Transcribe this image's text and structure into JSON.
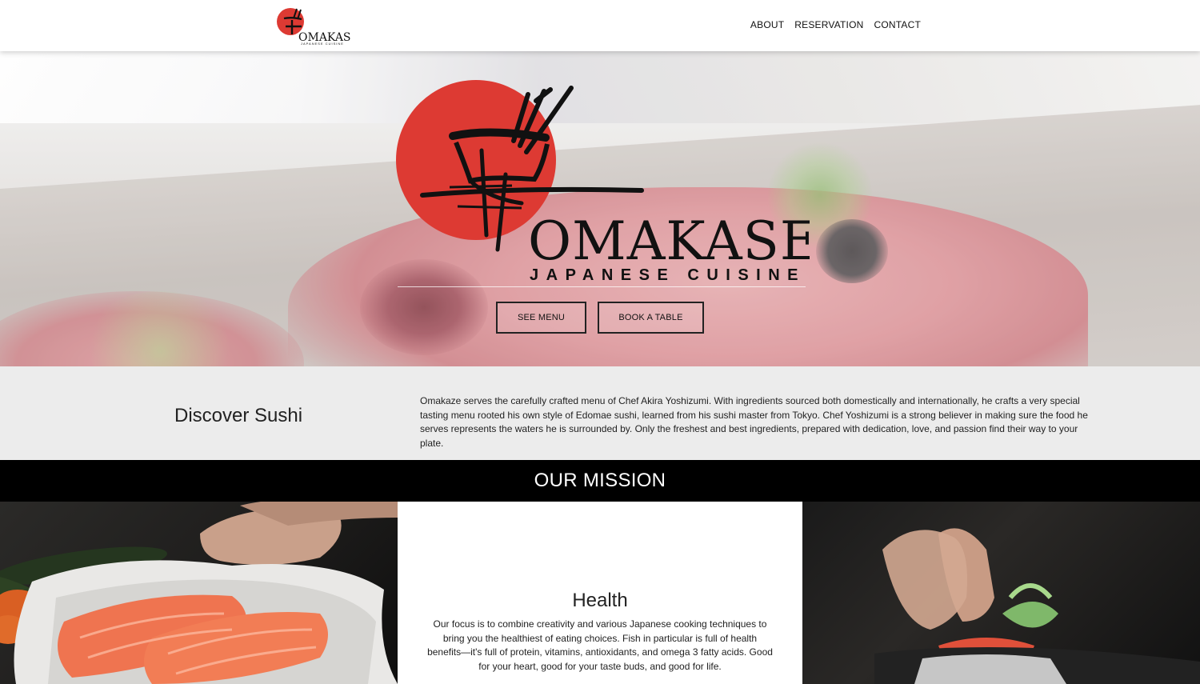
{
  "brand": {
    "name": "OMAKASE",
    "tagline": "JAPANESE CUISINE",
    "red": "#dd3a33"
  },
  "nav": {
    "items": [
      {
        "label": "ABOUT"
      },
      {
        "label": "RESERVATION"
      },
      {
        "label": "CONTACT"
      }
    ]
  },
  "hero": {
    "buttons": {
      "menu": "SEE MENU",
      "book": "BOOK A TABLE"
    }
  },
  "discover": {
    "title": "Discover Sushi",
    "text": "Omakaze serves the carefully crafted menu of Chef Akira Yoshizumi. With ingredients sourced both domestically and internationally, he crafts a very special tasting menu rooted his own style of Edomae sushi, learned from his sushi master from Tokyo. Chef Yoshizumi is a strong believer in making sure the food he serves represents the waters he is surrounded by. Only the freshest and best ingredients, prepared with dedication, love, and passion find their way to your plate."
  },
  "mission": {
    "title": "OUR MISSION",
    "health": {
      "title": "Health",
      "text": "Our focus is to combine creativity and various Japanese cooking techniques to bring you the healthiest of eating choices. Fish in particular is full of health benefits—it's full of protein, vitamins, antioxidants, and omega 3 fatty acids. Good for your heart, good for your taste buds, and good for life."
    }
  }
}
